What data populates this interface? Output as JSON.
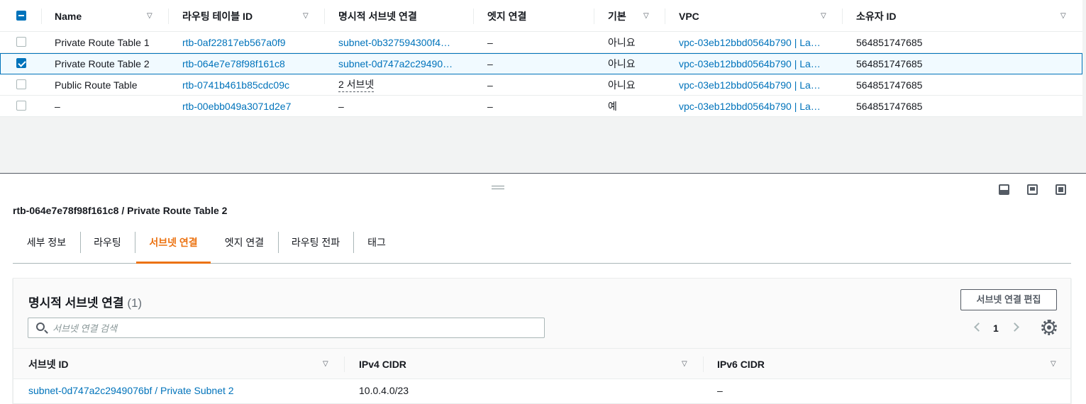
{
  "table": {
    "columns": [
      {
        "label": "Name"
      },
      {
        "label": "라우팅 테이블 ID"
      },
      {
        "label": "명시적 서브넷 연결"
      },
      {
        "label": "엣지 연결"
      },
      {
        "label": "기본"
      },
      {
        "label": "VPC"
      },
      {
        "label": "소유자 ID"
      }
    ],
    "rows": [
      {
        "selected": false,
        "name": "Private Route Table 1",
        "id": "rtb-0af22817eb567a0f9",
        "subnet": "subnet-0b327594300f4…",
        "edge": "–",
        "main": "아니요",
        "vpc": "vpc-03eb12bbd0564b790 | La…",
        "owner": "564851747685"
      },
      {
        "selected": true,
        "name": "Private Route Table 2",
        "id": "rtb-064e7e78f98f161c8",
        "subnet": "subnet-0d747a2c29490…",
        "edge": "–",
        "main": "아니요",
        "vpc": "vpc-03eb12bbd0564b790 | La…",
        "owner": "564851747685"
      },
      {
        "selected": false,
        "name": "Public Route Table",
        "id": "rtb-0741b461b85cdc09c",
        "subnet": "2 서브넷",
        "edge": "–",
        "main": "아니요",
        "vpc": "vpc-03eb12bbd0564b790 | La…",
        "owner": "564851747685"
      },
      {
        "selected": false,
        "name": "–",
        "id": "rtb-00ebb049a3071d2e7",
        "subnet": "–",
        "edge": "–",
        "main": "예",
        "vpc": "vpc-03eb12bbd0564b790 | La…",
        "owner": "564851747685"
      }
    ]
  },
  "detail": {
    "title": "rtb-064e7e78f98f161c8 / Private Route Table 2",
    "tabs": [
      {
        "label": "세부 정보",
        "active": false
      },
      {
        "label": "라우팅",
        "active": false
      },
      {
        "label": "서브넷 연결",
        "active": true
      },
      {
        "label": "엣지 연결",
        "active": false
      },
      {
        "label": "라우팅 전파",
        "active": false
      },
      {
        "label": "태그",
        "active": false
      }
    ]
  },
  "subnets": {
    "title": "명시적 서브넷 연결",
    "count": "(1)",
    "edit_button": "서브넷 연결 편집",
    "search_placeholder": "서브넷 연결 검색",
    "page": "1",
    "columns": [
      {
        "label": "서브넷 ID"
      },
      {
        "label": "IPv4 CIDR"
      },
      {
        "label": "IPv6 CIDR"
      }
    ],
    "rows": [
      {
        "subnet_id": "subnet-0d747a2c2949076bf / Private Subnet 2",
        "ipv4": "10.0.4.0/23",
        "ipv6": "–"
      }
    ]
  },
  "colors": {
    "link": "#0073bb",
    "active_tab": "#ec7211",
    "selected_row_bg": "#f1faff"
  }
}
